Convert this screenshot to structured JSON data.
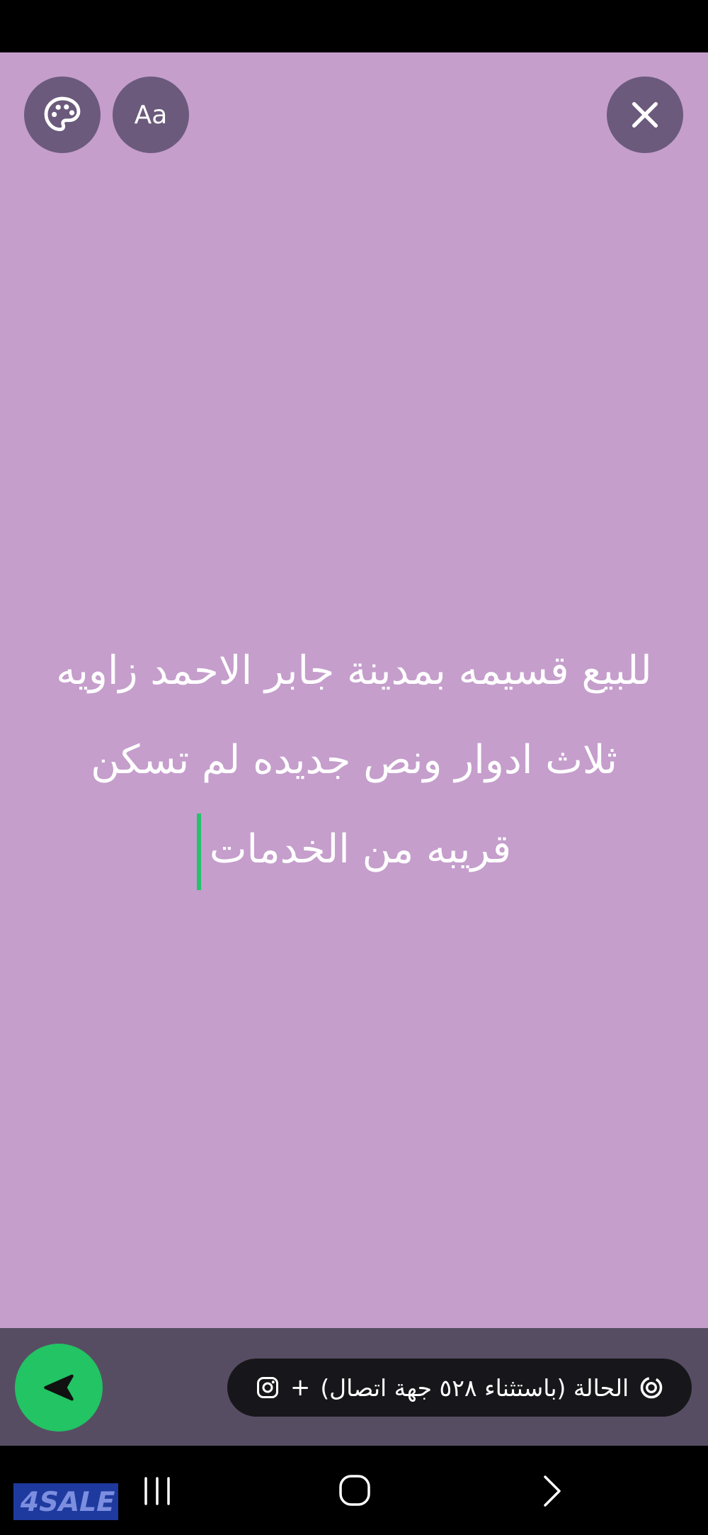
{
  "editor": {
    "font_button_label": "Aa",
    "status_lines": [
      "للبيع قسيمه بمدينة جابر الاحمد زاويه",
      "ثلاث ادوار ونص جديده لم تسكن",
      "قريبه من الخدمات"
    ],
    "background_color": "#c59ecc",
    "caret_color": "#25c26b"
  },
  "footer": {
    "audience_label": "الحالة (باستثناء ٥٢٨ جهة اتصال)",
    "plus_label": "+",
    "send_button_color": "#22c463"
  },
  "icons": {
    "palette": "palette-icon",
    "close": "close-icon",
    "send": "send-icon",
    "status_ring": "status-ring-icon",
    "instagram": "instagram-icon",
    "recents": "recents-icon",
    "home": "home-icon",
    "back": "back-icon"
  },
  "watermark": {
    "text": "4SALE"
  }
}
